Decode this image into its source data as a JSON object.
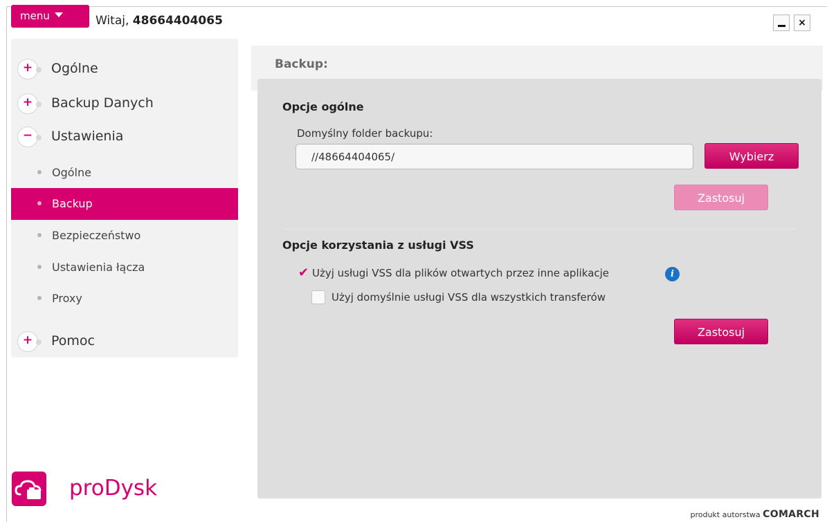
{
  "header": {
    "menu_label": "menu",
    "greeting_prefix": "Witaj,",
    "user_number": "48664404065",
    "minimize_label": "_",
    "close_label": "×"
  },
  "sidebar": {
    "categories": [
      {
        "label": "Ogólne",
        "state": "+"
      },
      {
        "label": "Backup Danych",
        "state": "+"
      },
      {
        "label": "Ustawienia",
        "state": "−"
      },
      {
        "label": "Pomoc",
        "state": "+"
      }
    ],
    "subitems": [
      {
        "label": "Ogólne"
      },
      {
        "label": "Backup"
      },
      {
        "label": "Bezpieczeństwo"
      },
      {
        "label": "Ustawienia łącza"
      },
      {
        "label": "Proxy"
      }
    ]
  },
  "main": {
    "title": "Backup:",
    "general": {
      "title": "Opcje ogólne",
      "folder_label": "Domyślny folder backupu:",
      "folder_value": "//48664404065/",
      "choose_label": "Wybierz",
      "apply_label": "Zastosuj"
    },
    "vss": {
      "title": "Opcje korzystania z usługi VSS",
      "option1": "Użyj usługi VSS dla plików otwartych przez inne aplikacje",
      "option1_checked": true,
      "option2": "Użyj domyślnie usługi VSS dla wszystkich transferów",
      "option2_checked": false,
      "apply_label": "Zastosuj"
    }
  },
  "footer": {
    "logo_text": "proDysk",
    "credit_prefix": "produkt autorstwa",
    "credit_brand": "COMARCH"
  },
  "colors": {
    "accent": "#d6006e",
    "panel": "#dedede",
    "sidebar": "#f2f2f2"
  }
}
